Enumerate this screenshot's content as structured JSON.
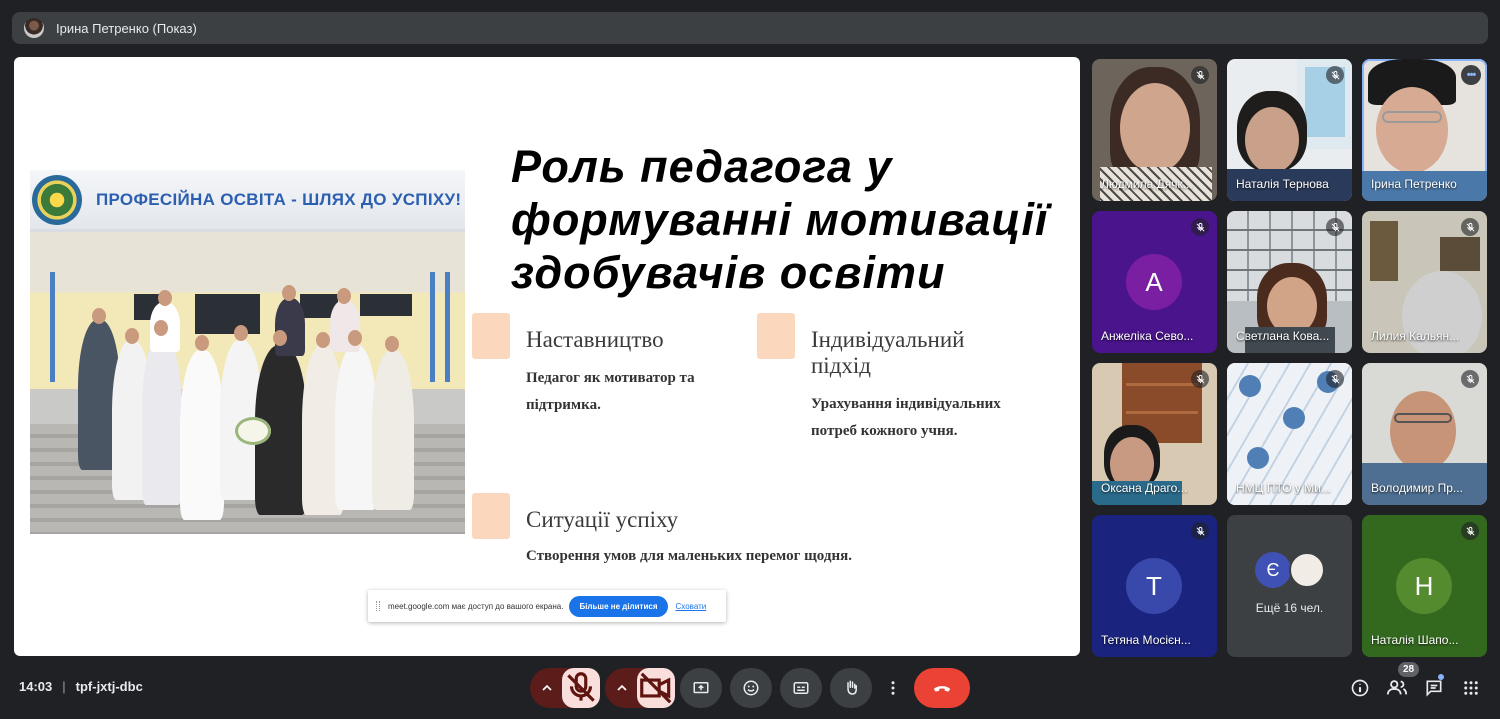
{
  "top_bar": {
    "presenter_label": "Ірина Петренко (Показ)"
  },
  "slide": {
    "photo_banner": "ПРОФЕСІЙНА ОСВІТА - ШЛЯХ ДО УСПІХУ!",
    "title": "Роль педагога у\nформуванні мотивації\nздобувачів освіти",
    "bullets": [
      {
        "heading": "Наставництво",
        "text": "Педагог як мотиватор та\nпідтримка."
      },
      {
        "heading": "Індивідуальний\nпідхід",
        "text": "Урахування індивідуальних\nпотреб кожного учня."
      },
      {
        "heading": "Ситуації успіху",
        "text": "Створення умов для маленьких перемог щодня."
      }
    ],
    "accent_color": "#fad7bd"
  },
  "share_toast": {
    "message": "meet.google.com має доступ до вашого екрана.",
    "stop_label": "Більше не ділитися",
    "hide_label": "Сховати"
  },
  "participants": [
    {
      "name": "Людмила Дячк...",
      "type": "video",
      "muted": true
    },
    {
      "name": "Наталія Тернова",
      "type": "video",
      "muted": true
    },
    {
      "name": "Ірина Петренко",
      "type": "video",
      "muted": false,
      "active": true
    },
    {
      "name": "Анжеліка Сево...",
      "type": "avatar",
      "initial": "А",
      "color": "#7b1fa2",
      "muted": true
    },
    {
      "name": "Светлана Кова...",
      "type": "video",
      "muted": true
    },
    {
      "name": "Лилия Кальян...",
      "type": "video",
      "muted": true
    },
    {
      "name": "Оксана Драго...",
      "type": "video",
      "muted": true
    },
    {
      "name": "НМЦ ПТО у Ми...",
      "type": "video",
      "muted": true
    },
    {
      "name": "Володимир Пр...",
      "type": "video",
      "muted": true
    },
    {
      "name": "Тетяна Мосієн...",
      "type": "avatar",
      "initial": "Т",
      "color": "#3949ab",
      "muted": true
    },
    {
      "name": "Ещё 16 чел.",
      "type": "overflow",
      "initial": "Є"
    },
    {
      "name": "Наталія Шапо...",
      "type": "avatar",
      "initial": "Н",
      "color": "#558b2f",
      "muted": true
    }
  ],
  "bottom_bar": {
    "time": "14:03",
    "meeting_code": "tpf-jxtj-dbc",
    "participant_count": "28",
    "icons": [
      "mic-off-icon",
      "camera-off-icon",
      "present-icon",
      "emoji-icon",
      "captions-icon",
      "raise-hand-icon",
      "more-icon",
      "end-call-icon",
      "info-icon",
      "people-icon",
      "chat-icon",
      "activities-icon"
    ]
  }
}
